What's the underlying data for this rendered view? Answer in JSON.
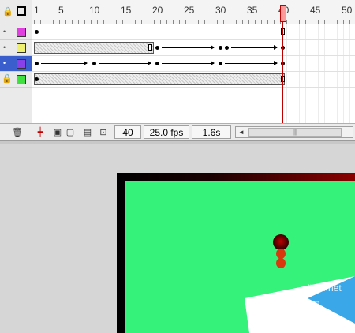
{
  "timeline": {
    "header_icons": [
      "lock-icon",
      "outline-square-icon"
    ],
    "ruler": [
      "1",
      "5",
      "10",
      "15",
      "20",
      "25",
      "30",
      "35",
      "40",
      "45",
      "50"
    ],
    "current_frame": "40",
    "layers": [
      {
        "color": "#e040e0",
        "locked": false,
        "selected": false
      },
      {
        "color": "#f0f070",
        "locked": false,
        "selected": false
      },
      {
        "color": "#8a40e8",
        "locked": true,
        "selected": true
      },
      {
        "color": "#40e040",
        "locked": true,
        "selected": false
      }
    ]
  },
  "status": {
    "frame": "40",
    "fps": "25.0 fps",
    "elapsed": "1.6s",
    "scroll_left": "◄",
    "scroll_grip": "|||"
  },
  "stage": {
    "border_color": "#000000",
    "fill_color": "#34f27a",
    "ball_color": "#d9380f"
  },
  "watermark": {
    "text": "查字典 教程网",
    "site": "ib51.net",
    "url": "jiaocheng.chazidian.com"
  }
}
